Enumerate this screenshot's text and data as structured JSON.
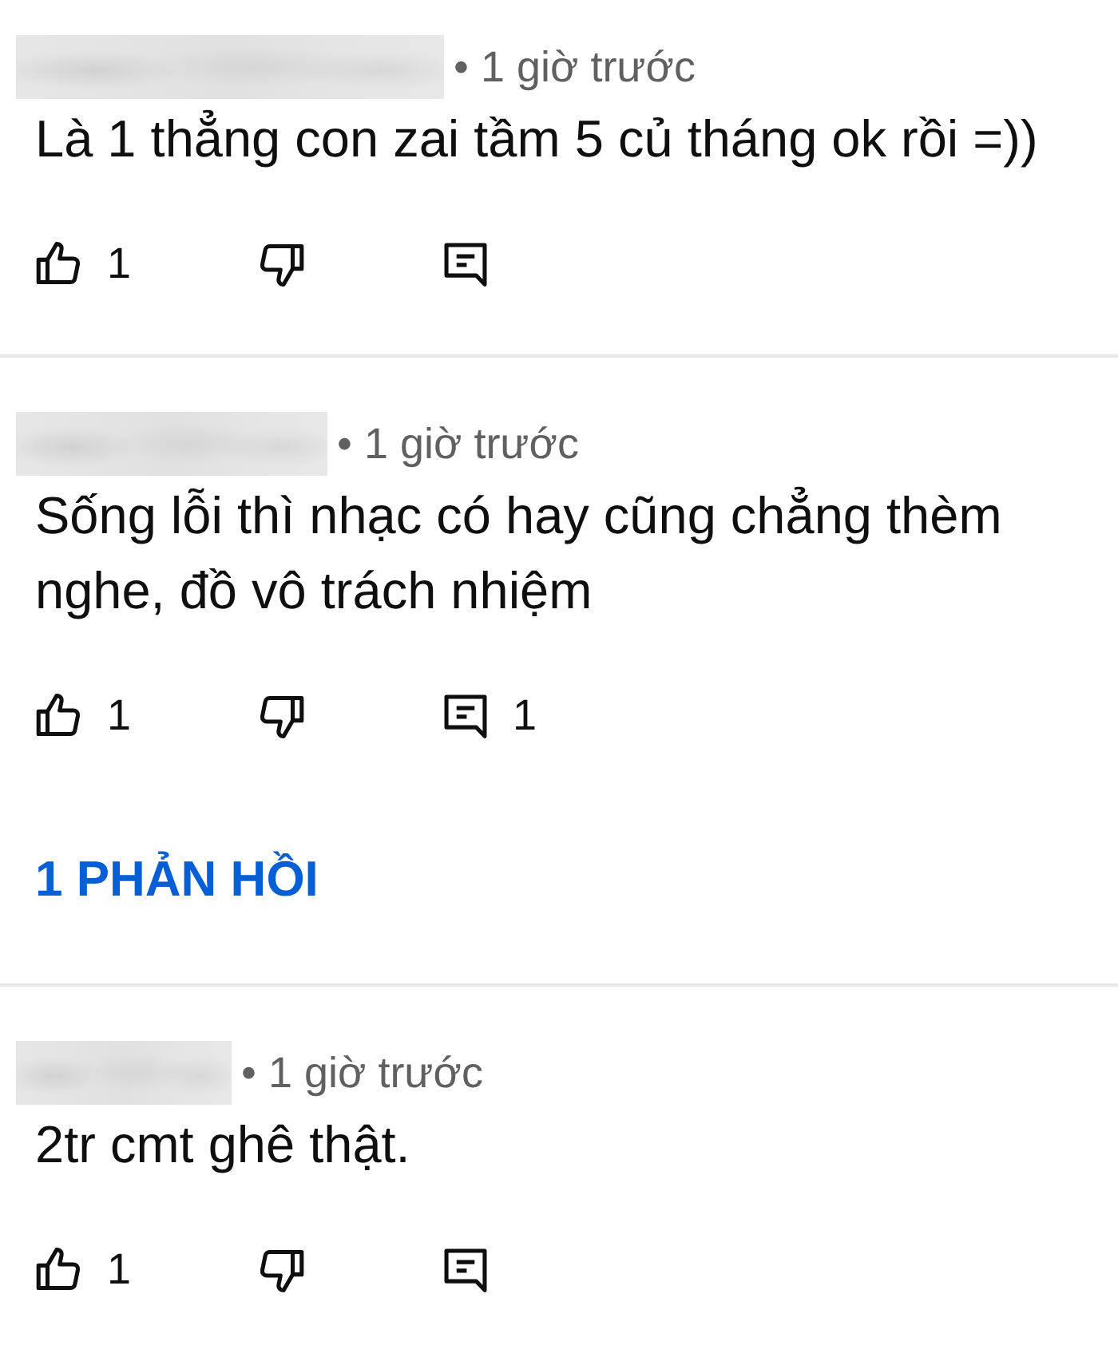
{
  "comments": [
    {
      "time": "• 1 giờ trước",
      "text": "Là 1 thẳng con zai tầm 5 củ tháng ok rồi =))",
      "likes": "1"
    },
    {
      "time": "• 1 giờ trước",
      "text": "Sống lỗi thì nhạc có hay cũng chẳng thèm nghe, đồ vô trách nhiệm",
      "likes": "1",
      "replies": "1",
      "replies_link": "1 PHẢN HỒI"
    },
    {
      "time": "• 1 giờ trước",
      "text": "2tr cmt ghê thật.",
      "likes": "1"
    }
  ]
}
